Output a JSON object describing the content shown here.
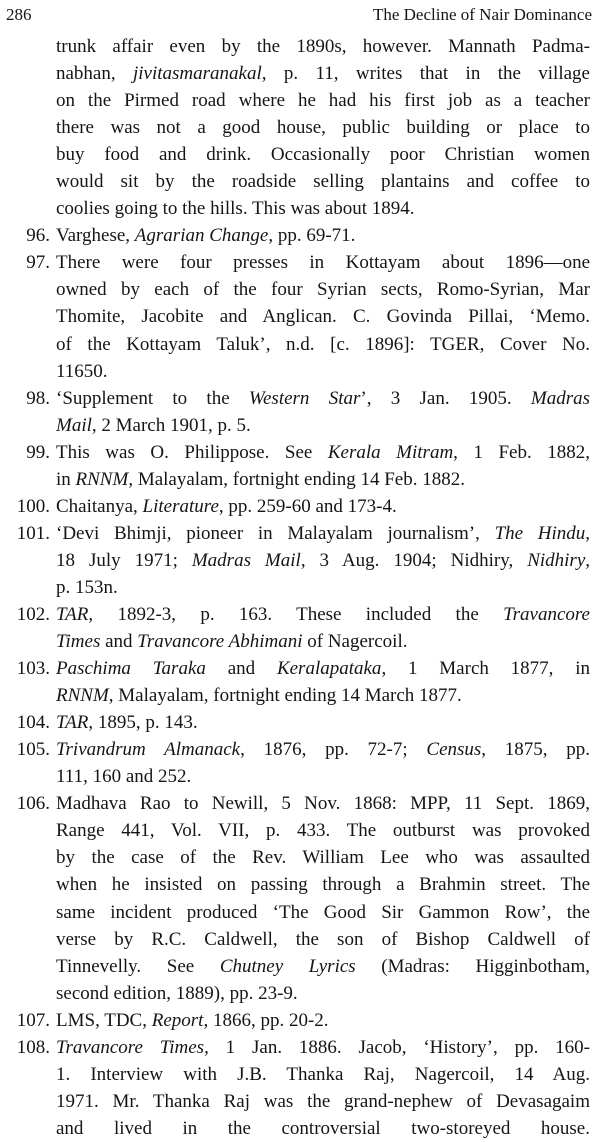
{
  "header": {
    "page_number": "286",
    "running_head": "The Decline of Nair Dominance"
  },
  "notes": [
    {
      "number": "",
      "lines": [
        [
          {
            "t": "trunk affair even by the 1890s, however.  Mannath Padma-"
          }
        ],
        [
          {
            "t": "nabhan, "
          },
          {
            "t": "jivitasmaranakal",
            "i": true
          },
          {
            "t": ", p. 11, writes that in the village"
          }
        ],
        [
          {
            "t": "on the Pirmed road where he had his first job as a teacher"
          }
        ],
        [
          {
            "t": "there was not a good house, public building or place to"
          }
        ],
        [
          {
            "t": "buy food and drink.  Occasionally poor Christian women"
          }
        ],
        [
          {
            "t": "would sit by the roadside selling plantains and coffee to"
          }
        ],
        [
          {
            "t": "coolies going to the hills. This was about 1894."
          }
        ]
      ]
    },
    {
      "number": "96.",
      "lines": [
        [
          {
            "t": "Varghese, "
          },
          {
            "t": "Agrarian Change",
            "i": true
          },
          {
            "t": ", pp. 69-71."
          }
        ]
      ]
    },
    {
      "number": "97.",
      "lines": [
        [
          {
            "t": "There were four presses in Kottayam about 1896—one"
          }
        ],
        [
          {
            "t": "owned by each of the four Syrian sects, Romo-Syrian, Mar"
          }
        ],
        [
          {
            "t": "Thomite, Jacobite and Anglican. C. Govinda Pillai, ‘Memo."
          }
        ],
        [
          {
            "t": "of the Kottayam Taluk’, n.d. [c. 1896]: TGER, Cover No."
          }
        ],
        [
          {
            "t": "11650."
          }
        ]
      ]
    },
    {
      "number": "98.",
      "lines": [
        [
          {
            "t": "‘Supplement to the "
          },
          {
            "t": "Western Star",
            "i": true
          },
          {
            "t": "’, 3 Jan. 1905.  "
          },
          {
            "t": "Madras",
            "i": true
          }
        ],
        [
          {
            "t": "Mail",
            "i": true
          },
          {
            "t": ", 2 March 1901, p. 5."
          }
        ]
      ]
    },
    {
      "number": "99.",
      "lines": [
        [
          {
            "t": "This was O. Philippose.  See "
          },
          {
            "t": "Kerala Mitram",
            "i": true
          },
          {
            "t": ", 1 Feb. 1882,"
          }
        ],
        [
          {
            "t": "in "
          },
          {
            "t": "RNNM",
            "i": true
          },
          {
            "t": ", Malayalam, fortnight ending 14 Feb. 1882."
          }
        ]
      ]
    },
    {
      "number": "100.",
      "lines": [
        [
          {
            "t": "Chaitanya, "
          },
          {
            "t": "Literature",
            "i": true
          },
          {
            "t": ", pp. 259-60 and 173-4."
          }
        ]
      ]
    },
    {
      "number": "101.",
      "lines": [
        [
          {
            "t": "‘Devi Bhimji, pioneer in Malayalam journalism’, "
          },
          {
            "t": "The Hindu",
            "i": true
          },
          {
            "t": ","
          }
        ],
        [
          {
            "t": "18 July 1971; "
          },
          {
            "t": "Madras Mail",
            "i": true
          },
          {
            "t": ", 3 Aug. 1904; Nidhiry, "
          },
          {
            "t": "Nidhiry",
            "i": true
          },
          {
            "t": ","
          }
        ],
        [
          {
            "t": "p. 153n."
          }
        ]
      ]
    },
    {
      "number": "102.",
      "lines": [
        [
          {
            "t": "TAR",
            "i": true
          },
          {
            "t": ", 1892-3, p. 163.   These included the "
          },
          {
            "t": "Travancore",
            "i": true
          }
        ],
        [
          {
            "t": "Times",
            "i": true
          },
          {
            "t": " and "
          },
          {
            "t": "Travancore Abhimani",
            "i": true
          },
          {
            "t": " of Nagercoil."
          }
        ]
      ]
    },
    {
      "number": "103.",
      "lines": [
        [
          {
            "t": "Paschima Taraka",
            "i": true
          },
          {
            "t": " and "
          },
          {
            "t": "Keralapataka",
            "i": true
          },
          {
            "t": ", 1 March 1877, in"
          }
        ],
        [
          {
            "t": "RNNM",
            "i": true
          },
          {
            "t": ", Malayalam, fortnight ending 14 March 1877."
          }
        ]
      ]
    },
    {
      "number": "104.",
      "lines": [
        [
          {
            "t": "TAR",
            "i": true
          },
          {
            "t": ", 1895, p. 143."
          }
        ]
      ]
    },
    {
      "number": "105.",
      "lines": [
        [
          {
            "t": "Trivandrum Almanack",
            "i": true
          },
          {
            "t": ", 1876, pp. 72-7; "
          },
          {
            "t": "Census",
            "i": true
          },
          {
            "t": ", 1875, pp."
          }
        ],
        [
          {
            "t": "111, 160 and 252."
          }
        ]
      ]
    },
    {
      "number": "106.",
      "lines": [
        [
          {
            "t": "Madhava Rao to Newill, 5 Nov. 1868: MPP, 11 Sept. 1869,"
          }
        ],
        [
          {
            "t": "Range 441, Vol. VII, p. 433.  The outburst was provoked"
          }
        ],
        [
          {
            "t": "by the case of the Rev. William Lee who was assaulted"
          }
        ],
        [
          {
            "t": "when he insisted on passing through a Brahmin street.  The"
          }
        ],
        [
          {
            "t": "same incident produced ‘The Good Sir Gammon Row’, the"
          }
        ],
        [
          {
            "t": "verse by R.C. Caldwell, the son of Bishop Caldwell of"
          }
        ],
        [
          {
            "t": "Tinnevelly.  See "
          },
          {
            "t": "Chutney Lyrics",
            "i": true
          },
          {
            "t": " (Madras: Higginbotham,"
          }
        ],
        [
          {
            "t": "second edition, 1889), pp. 23-9."
          }
        ]
      ]
    },
    {
      "number": "107.",
      "lines": [
        [
          {
            "t": "LMS, TDC, "
          },
          {
            "t": "Report",
            "i": true
          },
          {
            "t": ", 1866, pp. 20-2."
          }
        ]
      ]
    },
    {
      "number": "108.",
      "lines": [
        [
          {
            "t": "Travancore Times",
            "i": true
          },
          {
            "t": ", 1 Jan. 1886.  Jacob, ‘History’, pp. 160-"
          }
        ],
        [
          {
            "t": "1.  Interview with J.B. Thanka Raj, Nagercoil, 14 Aug."
          }
        ],
        [
          {
            "t": "1971. Mr. Thanka Raj was the grand-nephew of Devasagaim"
          }
        ],
        [
          {
            "t": "and lived in the controversial two-storeyed house."
          }
        ]
      ]
    }
  ]
}
